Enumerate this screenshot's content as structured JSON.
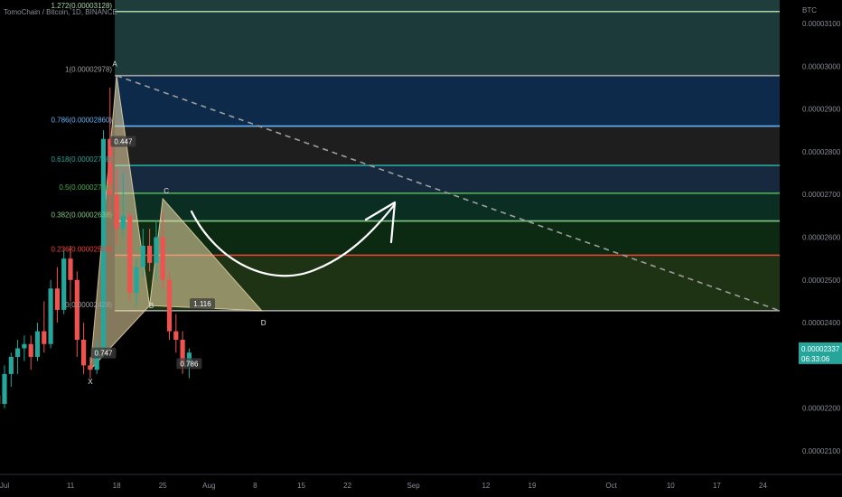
{
  "header": {
    "title": "TomoChain / Bitcoin, 1D, BINANCE",
    "currency": "BTC"
  },
  "price_badge": {
    "price": "0.00002337",
    "countdown": "06:33:06",
    "color": "#26a69a"
  },
  "chart_data": {
    "type": "candlestick",
    "y_axis": {
      "ticks": [
        {
          "value": 2.1e-05,
          "label": "0.00002100"
        },
        {
          "value": 2.2e-05,
          "label": "0.00002200"
        },
        {
          "value": 2.4e-05,
          "label": "0.00002400"
        },
        {
          "value": 2.5e-05,
          "label": "0.00002500"
        },
        {
          "value": 2.6e-05,
          "label": "0.00002600"
        },
        {
          "value": 2.7e-05,
          "label": "0.00002700"
        },
        {
          "value": 2.8e-05,
          "label": "0.00002800"
        },
        {
          "value": 2.9e-05,
          "label": "0.00002900"
        },
        {
          "value": 3e-05,
          "label": "0.00003000"
        },
        {
          "value": 3.1e-05,
          "label": "0.00003100"
        }
      ],
      "range": [
        2.05e-05,
        3.16e-05
      ]
    },
    "x_axis": {
      "start_date": "2019-06-30",
      "end_date": "2019-10-27",
      "ticks": [
        {
          "date": "2019-07-01",
          "label": "Jul"
        },
        {
          "date": "2019-07-11",
          "label": "11"
        },
        {
          "date": "2019-07-18",
          "label": "18"
        },
        {
          "date": "2019-07-25",
          "label": "25"
        },
        {
          "date": "2019-08-01",
          "label": "Aug"
        },
        {
          "date": "2019-08-08",
          "label": "8"
        },
        {
          "date": "2019-08-15",
          "label": "15"
        },
        {
          "date": "2019-08-22",
          "label": "22"
        },
        {
          "date": "2019-09-01",
          "label": "Sep"
        },
        {
          "date": "2019-09-12",
          "label": "12"
        },
        {
          "date": "2019-09-19",
          "label": "19"
        },
        {
          "date": "2019-10-01",
          "label": "Oct"
        },
        {
          "date": "2019-10-10",
          "label": "10"
        },
        {
          "date": "2019-10-17",
          "label": "17"
        },
        {
          "date": "2019-10-24",
          "label": "24"
        }
      ]
    },
    "fib_levels": [
      {
        "ratio": "1.272",
        "label": "1.272(0.00003128)",
        "value": 3.128e-05,
        "color": "#a5d6a7",
        "fill": "#1d3a3a"
      },
      {
        "ratio": "1",
        "label": "1(0.00002978)",
        "value": 2.978e-05,
        "color": "#9e9e9e",
        "fill": "#0d2a4a"
      },
      {
        "ratio": "0.786",
        "label": "0.786(0.00002860)",
        "value": 2.86e-05,
        "color": "#64b5f6",
        "fill": "#1e1e1e"
      },
      {
        "ratio": "0.618",
        "label": "0.618(0.00002768)",
        "value": 2.768e-05,
        "color": "#26a69a",
        "fill": "#16293e"
      },
      {
        "ratio": "0.5",
        "label": "0.5(0.00002703)",
        "value": 2.703e-05,
        "color": "#4caf50",
        "fill": "#0b2e23"
      },
      {
        "ratio": "0.382",
        "label": "0.382(0.00002638)",
        "value": 2.638e-05,
        "color": "#81c784",
        "fill": "#0c2a12"
      },
      {
        "ratio": "0.236",
        "label": "0.236(0.00002558)",
        "value": 2.558e-05,
        "color": "#f44336",
        "fill": "#1e3214"
      },
      {
        "ratio": "0",
        "label": "0(0.00002428)",
        "value": 2.428e-05,
        "color": "#9e9e9e",
        "fill": "#3a1010"
      }
    ],
    "harmonic": {
      "points": [
        {
          "name": "X",
          "date": "2019-07-14",
          "value": 2.29e-05
        },
        {
          "name": "A",
          "date": "2019-07-18",
          "value": 2.978e-05
        },
        {
          "name": "B",
          "date": "2019-07-23",
          "value": 2.44e-05
        },
        {
          "name": "C",
          "date": "2019-07-25",
          "value": 2.69e-05
        },
        {
          "name": "D",
          "date": "2019-08-09",
          "value": 2.428e-05
        }
      ],
      "ratios": [
        {
          "text": "0.447",
          "date": "2019-07-19",
          "value": 2.82e-05
        },
        {
          "text": "0.747",
          "date": "2019-07-16",
          "value": 2.325e-05
        },
        {
          "text": "1.116",
          "date": "2019-07-31",
          "value": 2.44e-05
        },
        {
          "text": "0.786",
          "date": "2019-07-29",
          "value": 2.3e-05
        }
      ]
    },
    "trendline": {
      "from_date": "2019-07-18",
      "from_value": 2.978e-05,
      "to_date": "2019-10-27",
      "to_value": 2.428e-05,
      "style": "dashed"
    },
    "candles": [
      {
        "d": "2019-06-30",
        "o": 2.23e-05,
        "h": 2.27e-05,
        "l": 2.18e-05,
        "c": 2.21e-05
      },
      {
        "d": "2019-07-01",
        "o": 2.21e-05,
        "h": 2.3e-05,
        "l": 2.2e-05,
        "c": 2.28e-05
      },
      {
        "d": "2019-07-02",
        "o": 2.28e-05,
        "h": 2.33e-05,
        "l": 2.25e-05,
        "c": 2.32e-05
      },
      {
        "d": "2019-07-03",
        "o": 2.32e-05,
        "h": 2.36e-05,
        "l": 2.28e-05,
        "c": 2.34e-05
      },
      {
        "d": "2019-07-04",
        "o": 2.34e-05,
        "h": 2.37e-05,
        "l": 2.31e-05,
        "c": 2.35e-05
      },
      {
        "d": "2019-07-05",
        "o": 2.35e-05,
        "h": 2.37e-05,
        "l": 2.29e-05,
        "c": 2.32e-05
      },
      {
        "d": "2019-07-06",
        "o": 2.32e-05,
        "h": 2.4e-05,
        "l": 2.31e-05,
        "c": 2.38e-05
      },
      {
        "d": "2019-07-07",
        "o": 2.38e-05,
        "h": 2.45e-05,
        "l": 2.33e-05,
        "c": 2.35e-05
      },
      {
        "d": "2019-07-08",
        "o": 2.35e-05,
        "h": 2.5e-05,
        "l": 2.34e-05,
        "c": 2.48e-05
      },
      {
        "d": "2019-07-09",
        "o": 2.48e-05,
        "h": 2.53e-05,
        "l": 2.4e-05,
        "c": 2.43e-05
      },
      {
        "d": "2019-07-10",
        "o": 2.43e-05,
        "h": 2.57e-05,
        "l": 2.42e-05,
        "c": 2.55e-05
      },
      {
        "d": "2019-07-11",
        "o": 2.55e-05,
        "h": 2.58e-05,
        "l": 2.45e-05,
        "c": 2.5e-05
      },
      {
        "d": "2019-07-12",
        "o": 2.5e-05,
        "h": 2.52e-05,
        "l": 2.32e-05,
        "c": 2.36e-05
      },
      {
        "d": "2019-07-13",
        "o": 2.36e-05,
        "h": 2.4e-05,
        "l": 2.28e-05,
        "c": 2.3e-05
      },
      {
        "d": "2019-07-14",
        "o": 2.3e-05,
        "h": 2.32e-05,
        "l": 2.27e-05,
        "c": 2.29e-05
      },
      {
        "d": "2019-07-15",
        "o": 2.29e-05,
        "h": 2.36e-05,
        "l": 2.28e-05,
        "c": 2.34e-05
      },
      {
        "d": "2019-07-16",
        "o": 2.34e-05,
        "h": 2.85e-05,
        "l": 2.32e-05,
        "c": 2.83e-05
      },
      {
        "d": "2019-07-17",
        "o": 2.83e-05,
        "h": 2.95e-05,
        "l": 2.65e-05,
        "c": 2.7e-05
      },
      {
        "d": "2019-07-18",
        "o": 2.7e-05,
        "h": 2.76e-05,
        "l": 2.58e-05,
        "c": 2.62e-05
      },
      {
        "d": "2019-07-19",
        "o": 2.62e-05,
        "h": 2.75e-05,
        "l": 2.6e-05,
        "c": 2.65e-05
      },
      {
        "d": "2019-07-20",
        "o": 2.65e-05,
        "h": 2.66e-05,
        "l": 2.45e-05,
        "c": 2.47e-05
      },
      {
        "d": "2019-07-21",
        "o": 2.47e-05,
        "h": 2.55e-05,
        "l": 2.44e-05,
        "c": 2.53e-05
      },
      {
        "d": "2019-07-22",
        "o": 2.53e-05,
        "h": 2.62e-05,
        "l": 2.51e-05,
        "c": 2.58e-05
      },
      {
        "d": "2019-07-23",
        "o": 2.58e-05,
        "h": 2.62e-05,
        "l": 2.52e-05,
        "c": 2.54e-05
      },
      {
        "d": "2019-07-24",
        "o": 2.54e-05,
        "h": 2.64e-05,
        "l": 2.5e-05,
        "c": 2.6e-05
      },
      {
        "d": "2019-07-25",
        "o": 2.6e-05,
        "h": 2.66e-05,
        "l": 2.48e-05,
        "c": 2.5e-05
      },
      {
        "d": "2019-07-26",
        "o": 2.5e-05,
        "h": 2.52e-05,
        "l": 2.36e-05,
        "c": 2.38e-05
      },
      {
        "d": "2019-07-27",
        "o": 2.38e-05,
        "h": 2.42e-05,
        "l": 2.33e-05,
        "c": 2.36e-05
      },
      {
        "d": "2019-07-28",
        "o": 2.36e-05,
        "h": 2.38e-05,
        "l": 2.28e-05,
        "c": 2.3e-05
      },
      {
        "d": "2019-07-29",
        "o": 2.3e-05,
        "h": 2.34e-05,
        "l": 2.27e-05,
        "c": 2.33e-05
      }
    ],
    "colors": {
      "up": "#26a69a",
      "down": "#ef5350"
    }
  }
}
